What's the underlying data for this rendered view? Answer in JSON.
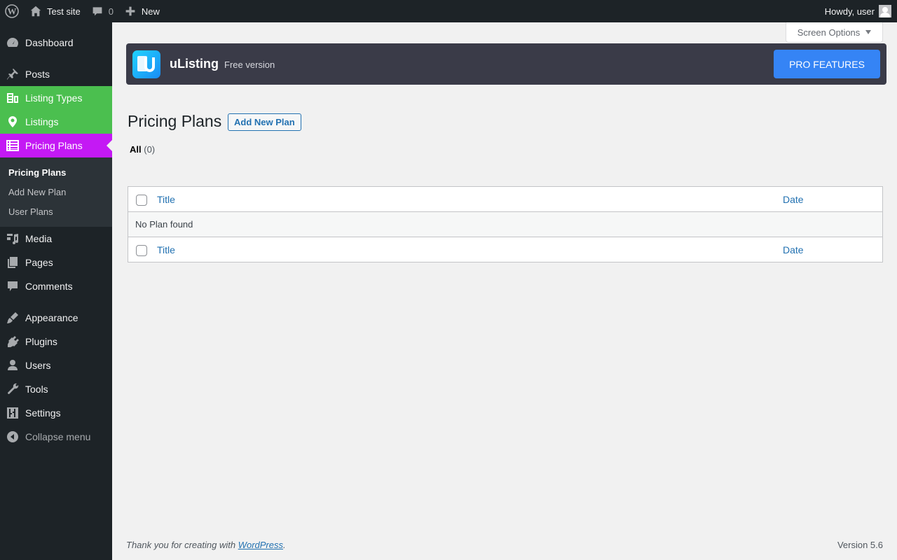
{
  "adminbar": {
    "site_name": "Test site",
    "comments_count": "0",
    "new_label": "New",
    "greeting": "Howdy, user"
  },
  "sidebar": {
    "items": [
      {
        "label": "Dashboard",
        "icon": "dashboard-icon"
      },
      {
        "label": "Posts",
        "icon": "pin-icon"
      },
      {
        "label": "Listing Types",
        "icon": "building-icon"
      },
      {
        "label": "Listings",
        "icon": "location-pin-icon"
      },
      {
        "label": "Pricing Plans",
        "icon": "table-list-icon"
      },
      {
        "label": "Media",
        "icon": "media-icon"
      },
      {
        "label": "Pages",
        "icon": "pages-icon"
      },
      {
        "label": "Comments",
        "icon": "comment-icon"
      },
      {
        "label": "Appearance",
        "icon": "brush-icon"
      },
      {
        "label": "Plugins",
        "icon": "plug-icon"
      },
      {
        "label": "Users",
        "icon": "user-icon"
      },
      {
        "label": "Tools",
        "icon": "wrench-icon"
      },
      {
        "label": "Settings",
        "icon": "sliders-icon"
      },
      {
        "label": "Collapse menu",
        "icon": "collapse-icon"
      }
    ],
    "submenu": [
      "Pricing Plans",
      "Add New Plan",
      "User Plans"
    ]
  },
  "screen_options": "Screen Options",
  "banner": {
    "brand": "uListing",
    "version": "Free version",
    "pro_button": "PRO FEATURES"
  },
  "page": {
    "title": "Pricing Plans",
    "add_new": "Add New Plan",
    "filter_all": "All",
    "filter_count": "(0)"
  },
  "table": {
    "columns": [
      "Title",
      "Date"
    ],
    "empty_message": "No Plan found"
  },
  "footer": {
    "thanks_prefix": "Thank you for creating with ",
    "wordpress_link": "WordPress",
    "thanks_suffix": ".",
    "version": "Version 5.6"
  },
  "colors": {
    "green_accent": "#4bbf4f",
    "magenta_accent": "#c419f4",
    "pro_blue": "#3584f5",
    "link_blue": "#2271b1"
  }
}
